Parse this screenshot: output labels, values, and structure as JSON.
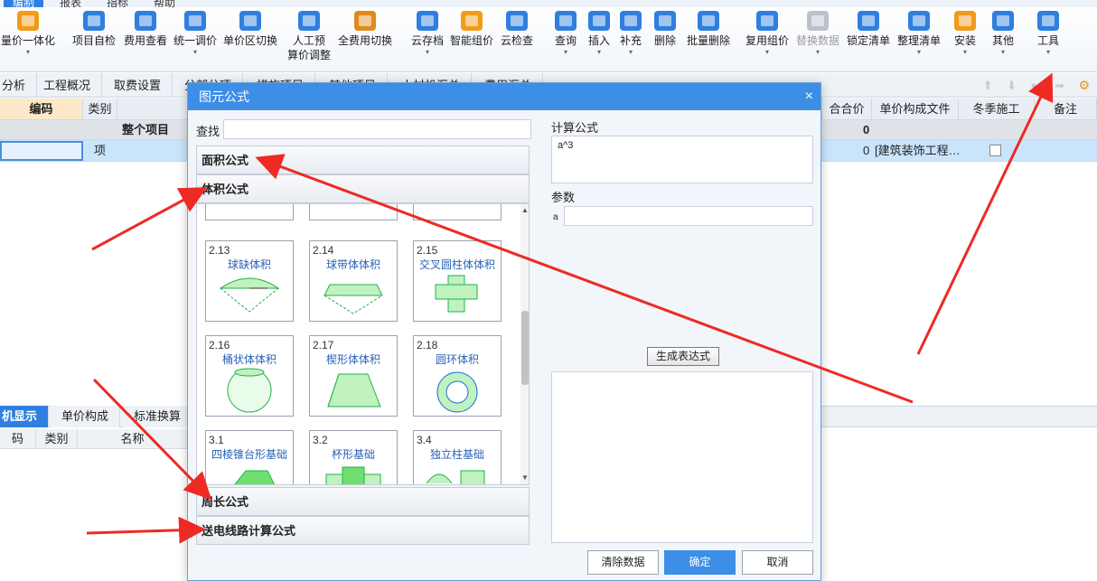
{
  "top_menu": {
    "items": [
      {
        "label": "编制"
      },
      {
        "label": "报表"
      },
      {
        "label": "指标"
      },
      {
        "label": "帮助"
      }
    ]
  },
  "ribbon": {
    "buttons": [
      {
        "label": "量价一体化",
        "color": "#f39a1a",
        "caret": "▾"
      },
      {
        "label": "项目自检",
        "color": "#2f7fe0"
      },
      {
        "label": "费用查看",
        "color": "#2f7fe0"
      },
      {
        "label": "统一调价",
        "color": "#2f7fe0",
        "caret": "▾"
      },
      {
        "label": "单价区切换",
        "color": "#2f7fe0"
      },
      {
        "label": "人工预\n算价调整",
        "color": "#2f7fe0"
      },
      {
        "label": "全费用切换",
        "color": "#e08a1e"
      },
      {
        "label": "云存档",
        "color": "#2f7fe0",
        "caret": "▾"
      },
      {
        "label": "智能组价",
        "color": "#f39a1a"
      },
      {
        "label": "云检查",
        "color": "#2f7fe0"
      },
      {
        "label": "查询",
        "color": "#2f7fe0",
        "caret": "▾"
      },
      {
        "label": "插入",
        "color": "#2f7fe0",
        "caret": "▾"
      },
      {
        "label": "补充",
        "color": "#2f7fe0",
        "caret": "▾"
      },
      {
        "label": "删除",
        "color": "#2f7fe0"
      },
      {
        "label": "批量删除",
        "color": "#2f7fe0"
      },
      {
        "label": "复用组价",
        "color": "#2f7fe0",
        "caret": "▾"
      },
      {
        "label": "替换数据",
        "color": "#b9c1cc",
        "disabled": true,
        "caret": "▾"
      },
      {
        "label": "锁定清单",
        "color": "#2f7fe0"
      },
      {
        "label": "整理清单",
        "color": "#2f7fe0",
        "caret": "▾"
      },
      {
        "label": "安装",
        "color": "#f39a1a",
        "caret": "▾"
      },
      {
        "label": "其他",
        "color": "#2f7fe0",
        "caret": "▾"
      },
      {
        "label": "工具",
        "color": "#2f7fe0",
        "caret": "▾"
      }
    ]
  },
  "tabs": [
    {
      "label": "分析"
    },
    {
      "label": "工程概况"
    },
    {
      "label": "取费设置"
    },
    {
      "label": "分部分项"
    },
    {
      "label": "措施项目"
    },
    {
      "label": "其他项目"
    },
    {
      "label": "人材机汇总"
    },
    {
      "label": "费用汇总"
    }
  ],
  "nav_arrows": "⬆ ⬇ ⬅ ➡",
  "grid": {
    "headers": [
      {
        "label": "编码"
      },
      {
        "label": "类别"
      },
      {
        "label": "合合价"
      },
      {
        "label": "单价构成文件"
      },
      {
        "label": "冬季施工"
      },
      {
        "label": "备注"
      }
    ],
    "row1": {
      "name": "整个项目",
      "value": "0"
    },
    "row2": {
      "category": "项",
      "value": "0",
      "file": "[建筑装饰工程…"
    }
  },
  "bottom": {
    "tabs": [
      {
        "label": "机显示"
      },
      {
        "label": "单价构成"
      },
      {
        "label": "标准换算"
      }
    ],
    "headers": [
      {
        "label": "码"
      },
      {
        "label": "类别"
      },
      {
        "label": "名称"
      }
    ]
  },
  "dialog": {
    "title": "图元公式",
    "close_icon": "×",
    "find_label": "查找",
    "find_value": "",
    "categories": {
      "area": "面积公式",
      "volume": "体积公式",
      "perimeter": "周长公式",
      "transmission": "送电线路计算公式"
    },
    "tiles": [
      {
        "num": "2.13",
        "name": "球缺体积"
      },
      {
        "num": "2.14",
        "name": "球带体体积"
      },
      {
        "num": "2.15",
        "name": "交叉圆柱体体积"
      },
      {
        "num": "2.16",
        "name": "桶状体体积"
      },
      {
        "num": "2.17",
        "name": "楔形体体积"
      },
      {
        "num": "2.18",
        "name": "圆环体积"
      },
      {
        "num": "3.1",
        "name": "四棱锥台形基础"
      },
      {
        "num": "3.2",
        "name": "杯形基础"
      },
      {
        "num": "3.4",
        "name": "独立柱基础"
      }
    ],
    "formula_label": "计算公式",
    "formula_value": "a^3",
    "params_label": "参数",
    "param_name": "a",
    "generate_label": "生成表达式",
    "buttons": {
      "clear": "清除数据",
      "ok": "确定",
      "cancel": "取消"
    }
  }
}
